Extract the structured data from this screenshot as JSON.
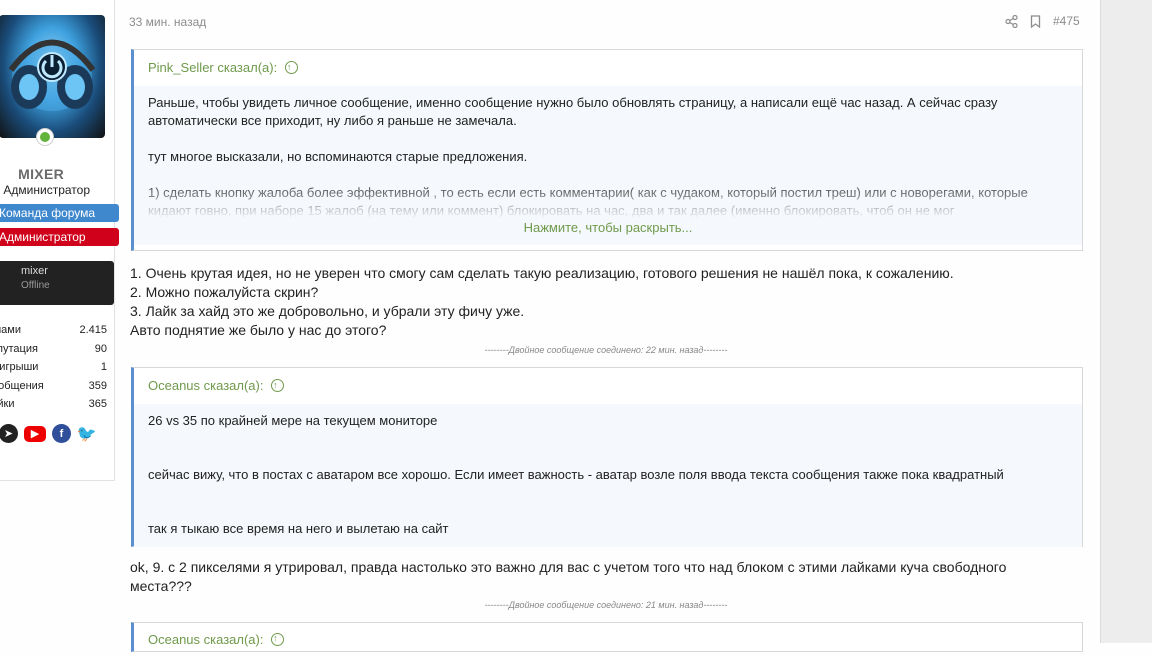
{
  "user": {
    "username": "MIXER",
    "title": "Администратор",
    "banners": [
      "Команда форума",
      "Администратор"
    ],
    "mini_profile": {
      "name": "mixer",
      "status": "Offline"
    },
    "stats": [
      {
        "label": "С нами:",
        "value": "2.415"
      },
      {
        "label": "Репутация:",
        "value": "90"
      },
      {
        "label": "Выигрыши:",
        "value": "1"
      },
      {
        "label": "Сообщения:",
        "value": "359"
      },
      {
        "label": "Лайки:",
        "value": "365"
      }
    ],
    "social_icons": [
      "x-icon",
      "telegram-icon",
      "youtube-icon",
      "facebook-icon",
      "twitter-icon"
    ]
  },
  "post": {
    "time": "33 мин. назад",
    "number": "#475",
    "quote1": {
      "author": "Pink_Seller сказал(а):",
      "paragraphs": [
        "Раньше, чтобы увидеть личное сообщение, именно сообщение нужно было обновлять страницу, а написали ещё час назад. А сейчас сразу автоматически все приходит, ну либо я раньше не замечала.",
        "тут многое высказали, но вспоминаются старые предложения.",
        "1) сделать кнопку жалоба более эффективной , то есть если есть комментарии( как с чудаком, который постил треш) или с новорегами, которые кидают говно, при наборе 15 жалоб (на тему или коммент) блокировать на час, два и так далее (именно блокировать, чтоб он не мог"
      ],
      "expand": "Нажмите, чтобы раскрыть..."
    },
    "reply1": [
      "1. Очень крутая идея, но не уверен что смогу сам сделать такую реализацию, готового решения не нашёл пока, к сожалению.",
      "2. Можно пожалуйста скрин?",
      "3. Лайк за хайд это же добровольно, и убрали эту фичу уже.",
      "Авто поднятие же было у нас до этого?"
    ],
    "merged1": "--------Двойное сообщение соединено: 22 мин. назад--------",
    "quote2": {
      "author": "Oceanus сказал(а):",
      "paragraphs": [
        "26 vs 35 по крайней мере на текущем мониторе",
        "сейчас вижу, что в постах с аватаром все хорошо. Если имеет важность - аватар возле поля ввода текста сообщения также пока квадратный",
        "так я тыкаю все время на него и вылетаю на сайт"
      ]
    },
    "reply2": "ok, 9. с 2 пикселями я утрировал, правда настолько это важно для вас с учетом того что над блоком с этими лайками куча свободного места???",
    "merged2": "--------Двойное сообщение соединено: 21 мин. назад--------",
    "quote3": {
      "author": "Oceanus сказал(а):"
    }
  }
}
